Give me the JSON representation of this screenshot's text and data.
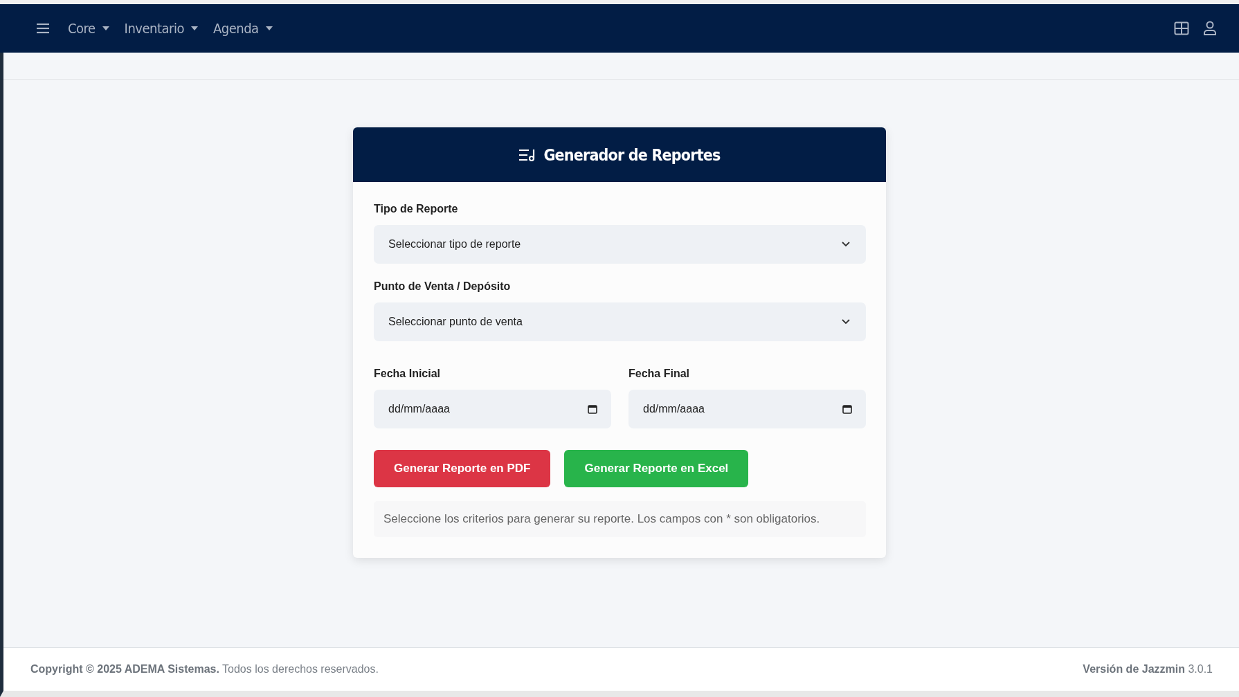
{
  "navbar": {
    "menu": [
      {
        "label": "Core"
      },
      {
        "label": "Inventario"
      },
      {
        "label": "Agenda"
      }
    ]
  },
  "card": {
    "title": "Generador de Reportes",
    "fields": [
      {
        "kind": "select",
        "label": "Tipo de Reporte",
        "value": "Seleccionar tipo de reporte"
      },
      {
        "kind": "select",
        "label": "Punto de Venta / Depósito",
        "value": "Seleccionar punto de venta"
      }
    ],
    "dates": [
      {
        "label": "Fecha Inicial",
        "placeholder": "dd/mm/aaaa"
      },
      {
        "label": "Fecha Final",
        "placeholder": "dd/mm/aaaa"
      }
    ],
    "buttons": [
      {
        "kind": "danger",
        "label": "Generar Reporte en PDF"
      },
      {
        "kind": "success",
        "label": "Generar Reporte en Excel"
      }
    ],
    "help": "Seleccione los criterios para generar su reporte. Los campos con * son obligatorios."
  },
  "footer": {
    "copyright": "**Copyright © 2025 ADEMA Sistemas.** Todos los derechos reservados.",
    "version": "**Versión de Jazzmin** 3.0.1"
  }
}
